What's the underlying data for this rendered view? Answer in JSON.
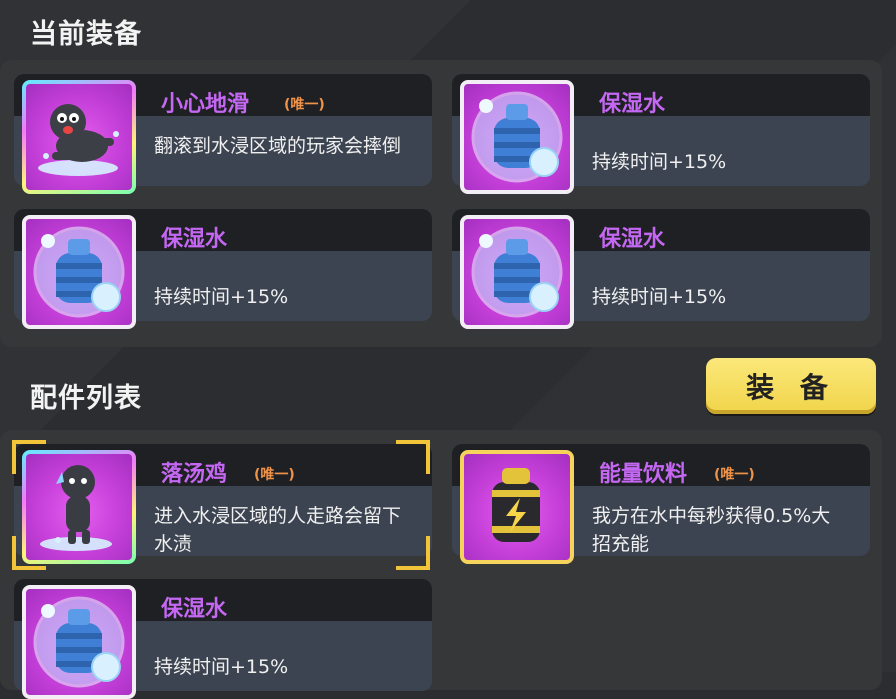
{
  "sections": {
    "current_title": "当前装备",
    "list_title": "配件列表"
  },
  "equip_button_label": "装 备",
  "current_items": [
    {
      "name": "小心地滑",
      "tag": "(唯一)",
      "desc": "翻滚到水浸区域的玩家会摔倒",
      "icon": "slipping-character-icon"
    },
    {
      "name": "保湿水",
      "tag": "",
      "desc": "持续时间+15%",
      "icon": "water-bottle-icon"
    },
    {
      "name": "保湿水",
      "tag": "",
      "desc": "持续时间+15%",
      "icon": "water-bottle-icon"
    },
    {
      "name": "保湿水",
      "tag": "",
      "desc": "持续时间+15%",
      "icon": "water-bottle-icon"
    }
  ],
  "list_items": [
    {
      "name": "落汤鸡",
      "tag": "(唯一)",
      "desc": "进入水浸区域的人走路会留下水渍",
      "icon": "wet-character-icon",
      "selected": true
    },
    {
      "name": "能量饮料",
      "tag": "(唯一)",
      "desc": "我方在水中每秒获得0.5%大招充能",
      "icon": "energy-drink-icon"
    },
    {
      "name": "保湿水",
      "tag": "",
      "desc": "持续时间+15%",
      "icon": "water-bottle-icon"
    }
  ],
  "colors": {
    "item_name": "#c467f2",
    "unique_tag": "#f09348",
    "equip_button": "#f1d44a",
    "selection_corner": "#f2c43a",
    "icon_bg": "#c43fd8"
  }
}
